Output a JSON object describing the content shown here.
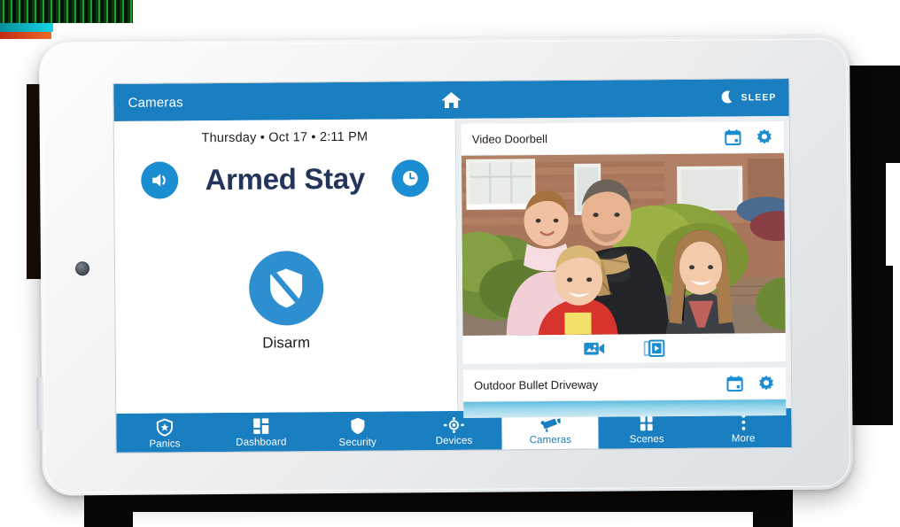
{
  "device": {
    "type": "tablet",
    "bezel_color": "#e9ecef",
    "sensor": "front-camera-sensor"
  },
  "theme": {
    "primary_blue": "#1a7fc1",
    "icon_blue": "#1a8ed1",
    "disarm_blue": "#2e8fd0",
    "arm_text_navy": "#24355c",
    "panel_bg": "#eceff1",
    "card_bg": "#ffffff"
  },
  "appbar": {
    "title": "Cameras",
    "home_icon": "home-icon",
    "sleep_label": "SLEEP",
    "sleep_icon": "moon-icon"
  },
  "security_panel": {
    "datetime": "Thursday  •  Oct 17  •  2:11 PM",
    "day": "Thursday",
    "date": "Oct 17",
    "time": "2:11 PM",
    "arm_state": "Armed Stay",
    "volume_icon": "speaker-icon",
    "clock_icon": "clock-icon",
    "disarm_label": "Disarm",
    "disarm_icon": "shield-slash-icon"
  },
  "cameras": [
    {
      "name": "Video Doorbell",
      "calendar_icon": "calendar-icon",
      "settings_icon": "gear-icon",
      "scene": "Family of four standing outside a red brick house with hedges and a driveway",
      "controls": [
        {
          "icon": "video-record-icon",
          "name": "record-clip-button"
        },
        {
          "icon": "video-library-icon",
          "name": "view-clips-button"
        }
      ]
    },
    {
      "name": "Outdoor Bullet Driveway",
      "calendar_icon": "calendar-icon",
      "settings_icon": "gear-icon",
      "scene": "Sky coloured preview strip"
    }
  ],
  "bottom_nav": {
    "active": "Cameras",
    "items": [
      {
        "label": "Panics",
        "icon": "shield-star-icon",
        "active": false
      },
      {
        "label": "Dashboard",
        "icon": "grid-icon",
        "active": false
      },
      {
        "label": "Security",
        "icon": "shield-icon",
        "active": false
      },
      {
        "label": "Devices",
        "icon": "bulb-rays-icon",
        "active": false
      },
      {
        "label": "Cameras",
        "icon": "cctv-camera-icon",
        "active": true
      },
      {
        "label": "Scenes",
        "icon": "squares-icon",
        "active": false
      },
      {
        "label": "More",
        "icon": "dots-vertical-icon",
        "active": false
      }
    ]
  }
}
